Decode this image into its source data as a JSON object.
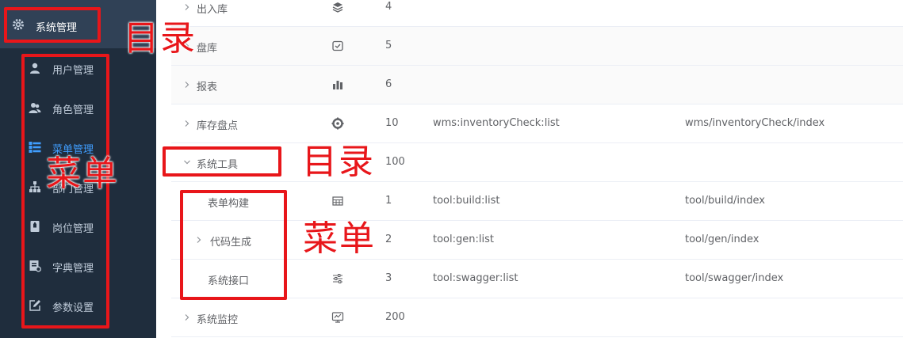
{
  "sidebar": {
    "top": {
      "label": "系统管理",
      "icon": "gear-icon"
    },
    "items": [
      {
        "label": "用户管理",
        "icon": "user-icon"
      },
      {
        "label": "角色管理",
        "icon": "users-icon"
      },
      {
        "label": "菜单管理",
        "icon": "tree-table-icon",
        "active": true
      },
      {
        "label": "部门管理",
        "icon": "org-tree-icon"
      },
      {
        "label": "岗位管理",
        "icon": "post-icon"
      },
      {
        "label": "字典管理",
        "icon": "dict-icon"
      },
      {
        "label": "参数设置",
        "icon": "edit-icon"
      }
    ],
    "active_color": "#409eff"
  },
  "menu_table": {
    "rows": [
      {
        "name": "出入库",
        "icon": "layers-icon",
        "order": "4",
        "perm": "",
        "path": "",
        "expand": "collapsed"
      },
      {
        "name": "盘库",
        "icon": "checkbox-icon",
        "order": "5",
        "perm": "",
        "path": "",
        "expand": "collapsed"
      },
      {
        "name": "报表",
        "icon": "bar-chart-icon",
        "order": "6",
        "perm": "",
        "path": "",
        "expand": "collapsed"
      },
      {
        "name": "库存盘点",
        "icon": "target-icon",
        "order": "10",
        "perm": "wms:inventoryCheck:list",
        "path": "wms/inventoryCheck/index",
        "expand": "collapsed"
      },
      {
        "name": "系统工具",
        "icon": "",
        "order": "100",
        "perm": "",
        "path": "",
        "expand": "expanded"
      },
      {
        "name": "表单构建",
        "icon": "build-icon",
        "order": "1",
        "perm": "tool:build:list",
        "path": "tool/build/index",
        "expand": "none"
      },
      {
        "name": "代码生成",
        "icon": "",
        "order": "2",
        "perm": "tool:gen:list",
        "path": "tool/gen/index",
        "expand": "collapsed"
      },
      {
        "name": "系统接口",
        "icon": "sliders-icon",
        "order": "3",
        "perm": "tool:swagger:list",
        "path": "tool/swagger/index",
        "expand": "none"
      },
      {
        "name": "系统监控",
        "icon": "monitor-icon",
        "order": "200",
        "perm": "",
        "path": "",
        "expand": "collapsed"
      }
    ]
  },
  "annotations": {
    "label_1": "目录",
    "label_2": "菜单",
    "label_3": "目录",
    "label_4": "菜单",
    "color": "#e8161a"
  }
}
